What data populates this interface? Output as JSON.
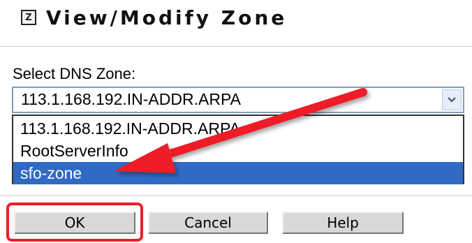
{
  "dialog": {
    "icon_glyph": "Z",
    "title": "View/Modify Zone"
  },
  "form": {
    "label": "Select DNS Zone:",
    "selected_value": "113.1.168.192.IN-ADDR.ARPA",
    "options": [
      "113.1.168.192.IN-ADDR.ARPA",
      "RootServerInfo",
      "sfo-zone"
    ],
    "highlighted_option": "sfo-zone"
  },
  "buttons": {
    "ok": "OK",
    "cancel": "Cancel",
    "help": "Help"
  },
  "colors": {
    "selection": "#316ac5",
    "annotation_red": "#ee1f25"
  }
}
